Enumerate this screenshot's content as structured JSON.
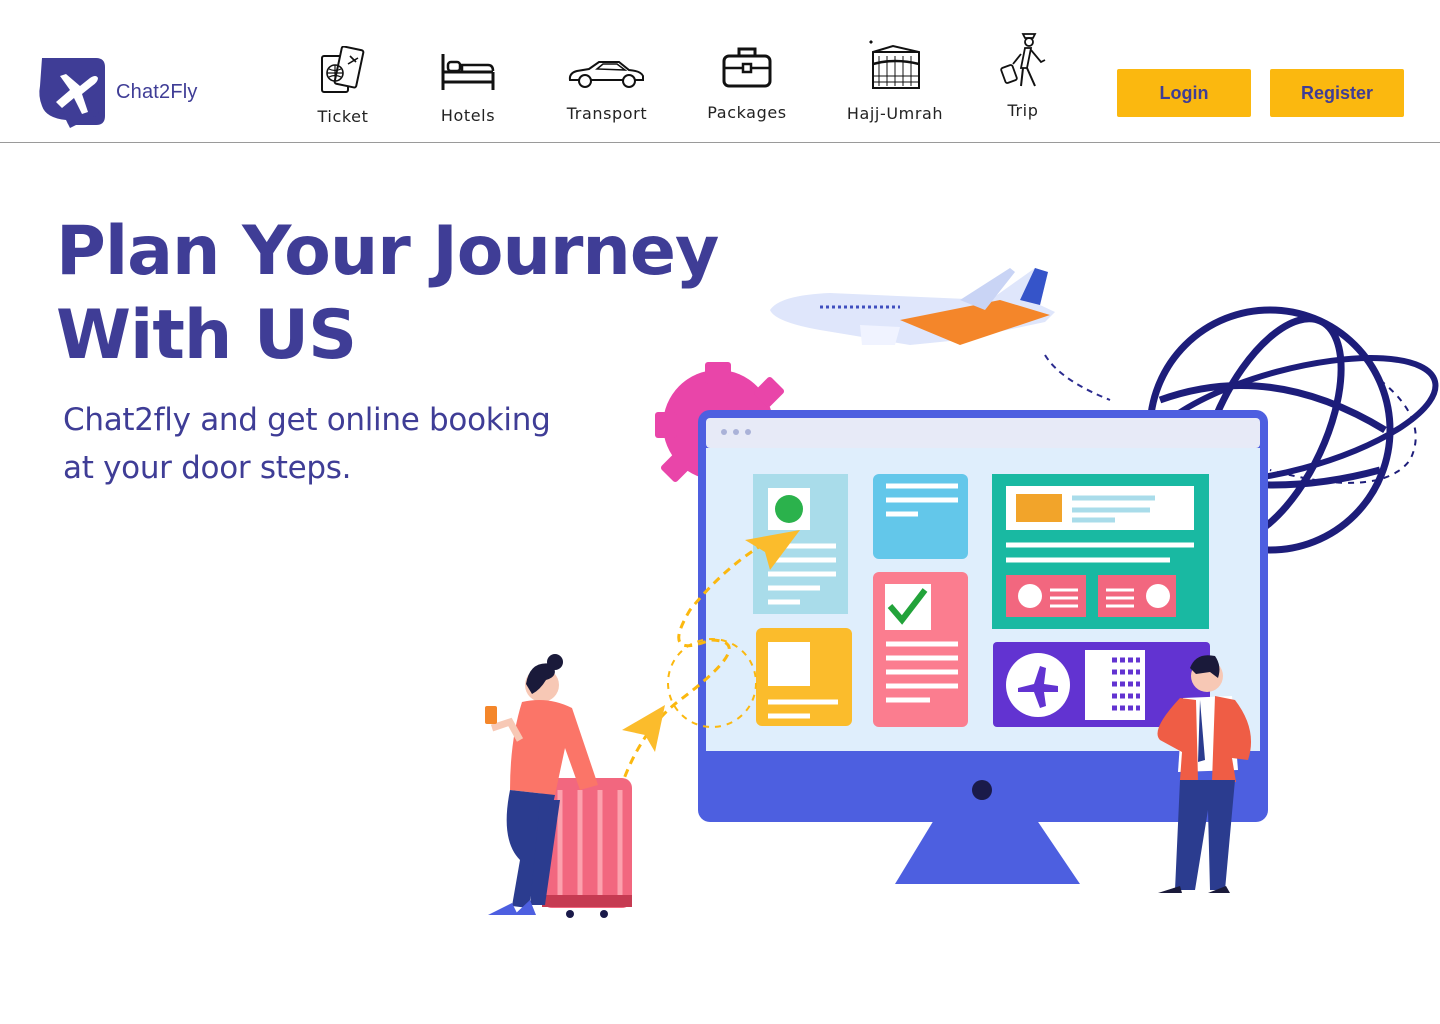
{
  "brand": {
    "name": "Chat2Fly",
    "color": "#3f3d96",
    "accent": "#fbb80f"
  },
  "nav": {
    "items": [
      {
        "label": "Ticket",
        "icon": "passport-ticket-icon"
      },
      {
        "label": "Hotels",
        "icon": "bed-icon"
      },
      {
        "label": "Transport",
        "icon": "car-icon"
      },
      {
        "label": "Packages",
        "icon": "briefcase-icon"
      },
      {
        "label": "Hajj-Umrah",
        "icon": "kaaba-icon"
      },
      {
        "label": "Trip",
        "icon": "traveler-icon"
      }
    ]
  },
  "auth": {
    "login_label": "Login",
    "register_label": "Register"
  },
  "hero": {
    "title_line1": "Plan Your Journey",
    "title_line2": "With US",
    "subtitle_line1": "Chat2fly and get online booking",
    "subtitle_line2": "at your door steps."
  }
}
